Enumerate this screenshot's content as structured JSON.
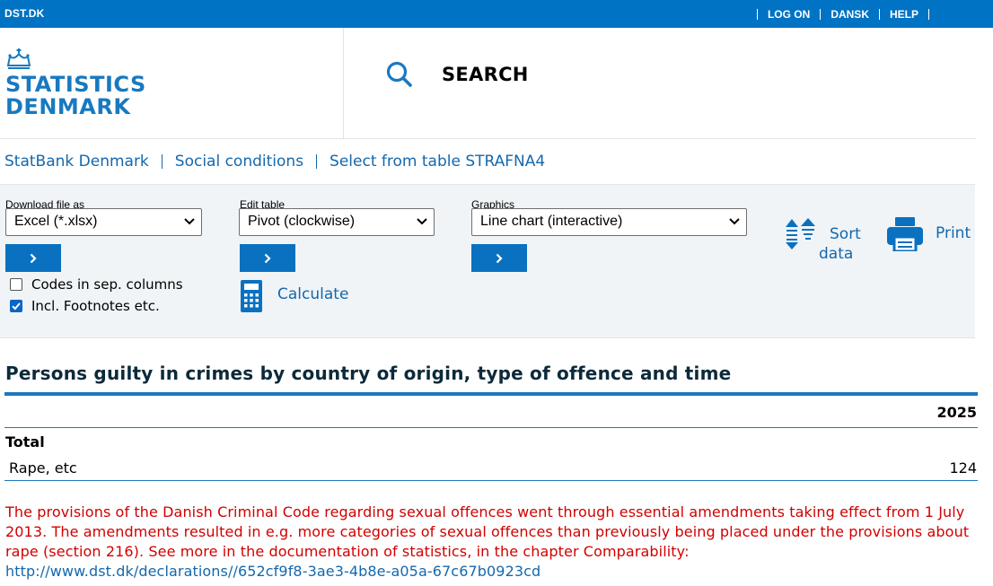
{
  "topbar": {
    "brand": "DST.DK",
    "links": [
      "LOG ON",
      "DANSK",
      "HELP"
    ]
  },
  "logo": {
    "line1": "STATISTICS",
    "line2": "DENMARK"
  },
  "search": {
    "label": "SEARCH"
  },
  "breadcrumb": [
    "StatBank Denmark",
    "Social conditions",
    "Select from table STRAFNA4"
  ],
  "toolbar": {
    "download": {
      "label": "Download file as",
      "value": "Excel (*.xlsx)"
    },
    "edit": {
      "label": "Edit table",
      "value": "Pivot (clockwise)"
    },
    "graphics": {
      "label": "Graphics",
      "value": "Line chart (interactive)"
    },
    "codes_label": "Codes in sep. columns",
    "codes_checked": false,
    "footnotes_label": "Incl. Footnotes etc.",
    "footnotes_checked": true,
    "calculate_label": "Calculate",
    "sort_line1": "Sort",
    "sort_line2": "data",
    "print_label": "Print"
  },
  "table": {
    "title": "Persons guilty in crimes by country of origin, type of offence and time",
    "year": "2025",
    "group": "Total",
    "row_label": "Rape, etc",
    "row_value": "124"
  },
  "footnote": {
    "text": "The provisions of the Danish Criminal Code regarding sexual offences went through essential amendments taking effect from 1 July 2013. The amendments resulted in e.g. more categories of sexual offences than previously being placed under the provisions about rape (section 216). See more in the documentation of statistics, in the chapter Comparability:",
    "link": "http://www.dst.dk/declarations//652cf9f8-3ae3-4b8e-a05a-67c67b0923cd"
  },
  "colors": {
    "brand_blue": "#0073c4",
    "link_blue": "#1468ad",
    "footnote_red": "#d10000"
  }
}
